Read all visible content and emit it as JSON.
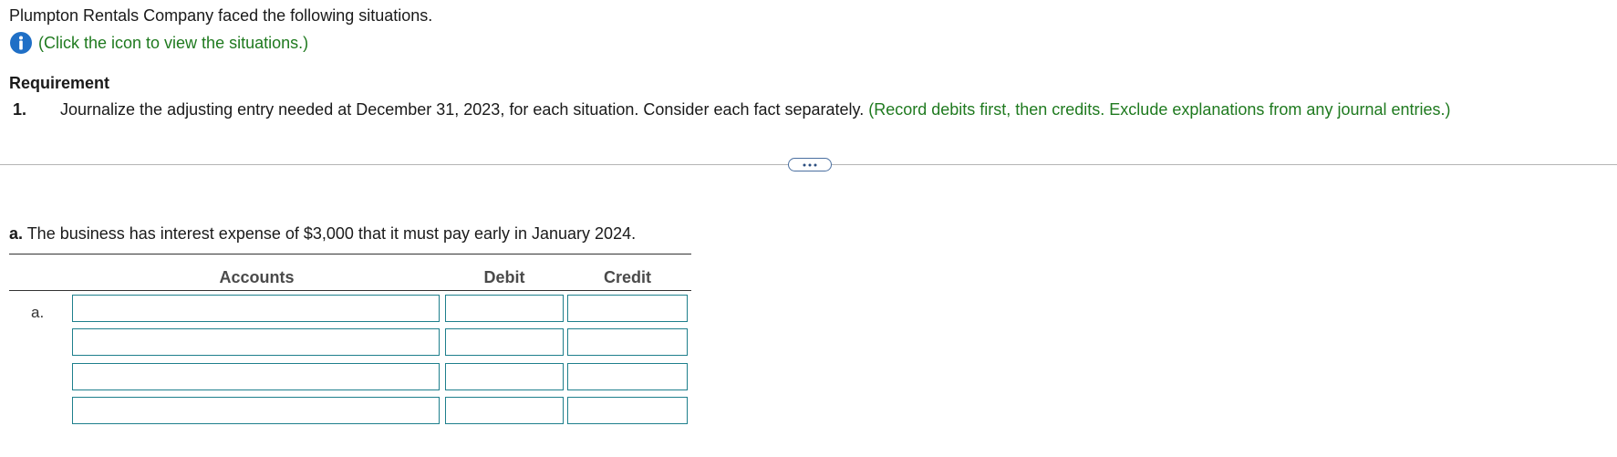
{
  "intro": {
    "text": "Plumpton Rentals Company faced the following situations.",
    "info_link": "(Click the icon to view the situations.)",
    "info_icon": "info-icon"
  },
  "requirement": {
    "title": "Requirement",
    "number": "1.",
    "text": "Journalize the adjusting entry needed at December 31, 2023, for each situation. Consider each fact separately. ",
    "note": "(Record debits first, then credits. Exclude explanations from any journal entries.)"
  },
  "divider": {
    "more_icon": "ellipsis-icon"
  },
  "situation": {
    "letter": "a.",
    "text": " The business has interest expense of $3,000 that it must pay early in January 2024."
  },
  "journal": {
    "headers": {
      "accounts": "Accounts",
      "debit": "Debit",
      "credit": "Credit"
    },
    "row_label": "a.",
    "rows": [
      {
        "account": "",
        "debit": "",
        "credit": ""
      },
      {
        "account": "",
        "debit": "",
        "credit": ""
      },
      {
        "account": "",
        "debit": "",
        "credit": ""
      },
      {
        "account": "",
        "debit": "",
        "credit": ""
      }
    ]
  },
  "colors": {
    "green_text": "#1f7a1f",
    "info_blue": "#1f6fc6",
    "input_border": "#1e7f8c"
  }
}
